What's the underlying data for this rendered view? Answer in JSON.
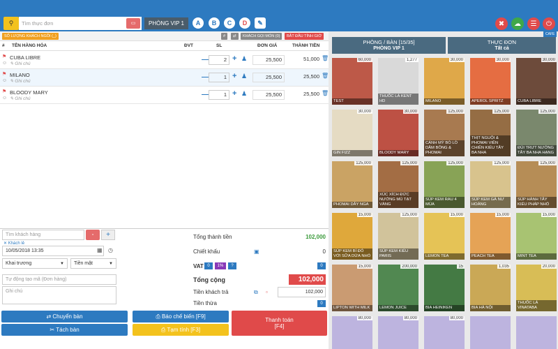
{
  "search": {
    "placeholder": "Tìm thực đơn",
    "kbd": "▭"
  },
  "room_label": "PHÒNG VIP 1",
  "price_levels": [
    "A",
    "B",
    "C",
    "D"
  ],
  "toolbar": {
    "guests_label": "SỐ LƯỢNG KHÁCH NGỒI",
    "guests_count": "(_)",
    "hash": "#",
    "guest_orders": "KHÁCH GỌI MÓN (0)",
    "start_time": "BẮT ĐẦU TÍNH GIỜ"
  },
  "table_headers": {
    "no": "#",
    "name": "TÊN HÀNG HÓA",
    "unit": "ĐVT",
    "qty": "SL",
    "price": "ĐƠN GIÁ",
    "total": "THÀNH TIỀN"
  },
  "items": [
    {
      "name": "CUBA LIBRE",
      "note": "Ghi chú",
      "qty": "2",
      "price": "25,500",
      "total": "51,000"
    },
    {
      "name": "MILANO",
      "note": "Ghi chú",
      "qty": "1",
      "price": "25,500",
      "total": "25,500"
    },
    {
      "name": "BLOODY MARY",
      "note": "Ghi chú",
      "qty": "1",
      "price": "25,500",
      "total": "25,500"
    }
  ],
  "customer": {
    "placeholder": "Tìm khách hàng",
    "guest_label": "Khách lẻ",
    "datetime": "10/05/2018 13:35",
    "sale_channel": "Khai trương",
    "payment_method": "Tiền mặt",
    "order_code_placeholder": "Tự động tạo mã (Đơn hàng)",
    "note_placeholder": "Ghi chú"
  },
  "summary": {
    "subtotal_label": "Tổng thành tiền",
    "subtotal": "102,000",
    "discount_label": "Chiết khấu",
    "discount": "0",
    "vat_label": "VAT",
    "vat_options": [
      "0",
      "1%",
      "?"
    ],
    "vat_value": "0",
    "total_label": "Tổng cộng",
    "total": "102,000",
    "paid_label": "Tiền khách trả",
    "paid": "102,000",
    "change_label": "Tiền thừa",
    "change": "0"
  },
  "buttons": {
    "move_table": "Chuyển bàn",
    "split_table": "Tách bàn",
    "kitchen_notice": "Báo chế biến [F9]",
    "provisional": "Tạm tính [F3]",
    "pay": "Thanh toán",
    "pay_key": "[F4]"
  },
  "right_tabs": {
    "rooms_title": "PHÒNG / BÀN [15/35]",
    "rooms_sub": "PHÒNG VIP 1",
    "menu_title": "THỰC ĐƠN",
    "menu_sub": "Tất cả",
    "cafe_badge": "CAFE"
  },
  "menu_items": [
    {
      "name": "TEST",
      "price": "60,000",
      "color": "#b8432f"
    },
    {
      "name": "THUỐC LÁ KENT HD",
      "price": "1,277",
      "color": "#d9d9d9"
    },
    {
      "name": "MILANO",
      "price": "30,000",
      "color": "#e0a030"
    },
    {
      "name": "APEROL SPRITZ",
      "price": "30,000",
      "color": "#e85a28"
    },
    {
      "name": "CUBA LIBRE",
      "price": "30,000",
      "color": "#5a3320"
    },
    {
      "name": "GIN FIZZ",
      "price": "30,000",
      "color": "#e8dcc0"
    },
    {
      "name": "BLOODY MARY",
      "price": "30,000",
      "color": "#b83a2a"
    },
    {
      "name": "CÁNH MỲ BÒ LÒ DĂM BÔNG & PHOMAI",
      "price": "125,000",
      "color": "#a06a38"
    },
    {
      "name": "THỊT NGUỘI & PHOMAI VIÊN CHIÊN KIỂU TÂY BA NHA",
      "price": "125,000",
      "color": "#8a5a2a"
    },
    {
      "name": "ĐÙI TRƯT NƯỚNG TÂY BA NHA HẠNG",
      "price": "125,000",
      "color": "#6a7a5a"
    },
    {
      "name": "PHOMAI DÂY NGA",
      "price": "125,000",
      "color": "#c89a50"
    },
    {
      "name": "XÚC XÍCH ĐỨC NƯỚNG MÙ TẠT VÀNG",
      "price": "125,000",
      "color": "#9a5a2a"
    },
    {
      "name": "SÚP KEM RAU 4 MÙA",
      "price": "125,000",
      "color": "#7a9a40"
    },
    {
      "name": "SÚP KEM GÀ NƯ HOÀNG",
      "price": "125,000",
      "color": "#d8c080"
    },
    {
      "name": "SÚP HÀNH TÂY KIỂU PHÁP NHỎ",
      "price": "125,000",
      "color": "#b08040"
    },
    {
      "name": "SÚP KEM BÍ ĐỎ VỚI SỮA DỪA NHỎ",
      "price": "15,000",
      "color": "#e0a020"
    },
    {
      "name": "SÚP KEM KIỂU PARIS",
      "price": "125,000",
      "color": "#d0c090"
    },
    {
      "name": "LEMON TEA",
      "price": "15,000",
      "color": "#e8c040"
    },
    {
      "name": "PEACH TEA",
      "price": "15,000",
      "color": "#e89a40"
    },
    {
      "name": "MINT TEA",
      "price": "15,000",
      "color": "#a0c060"
    },
    {
      "name": "LIPTON WITH MILK",
      "price": "15,000",
      "color": "#c89060"
    },
    {
      "name": "LEMON JUICE",
      "price": "200,000",
      "color": "#3a7a3a"
    },
    {
      "name": "BIA HEINIKEN",
      "price": "15",
      "color": "#2a6a2a"
    },
    {
      "name": "BIA HÀ NỘI",
      "price": "1,035",
      "color": "#c8a040"
    },
    {
      "name": "THUỐC LÁ VINATABA",
      "price": "20,000",
      "color": "#d8b840"
    },
    {
      "name": "",
      "price": "80,000",
      "color": "#b8aee0"
    },
    {
      "name": "",
      "price": "80,000",
      "color": "#b8aee0"
    },
    {
      "name": "",
      "price": "80,000",
      "color": "#b8aee0"
    },
    {
      "name": "",
      "price": "",
      "color": "#b8aee0"
    },
    {
      "name": "",
      "price": "",
      "color": "#b8aee0"
    }
  ]
}
